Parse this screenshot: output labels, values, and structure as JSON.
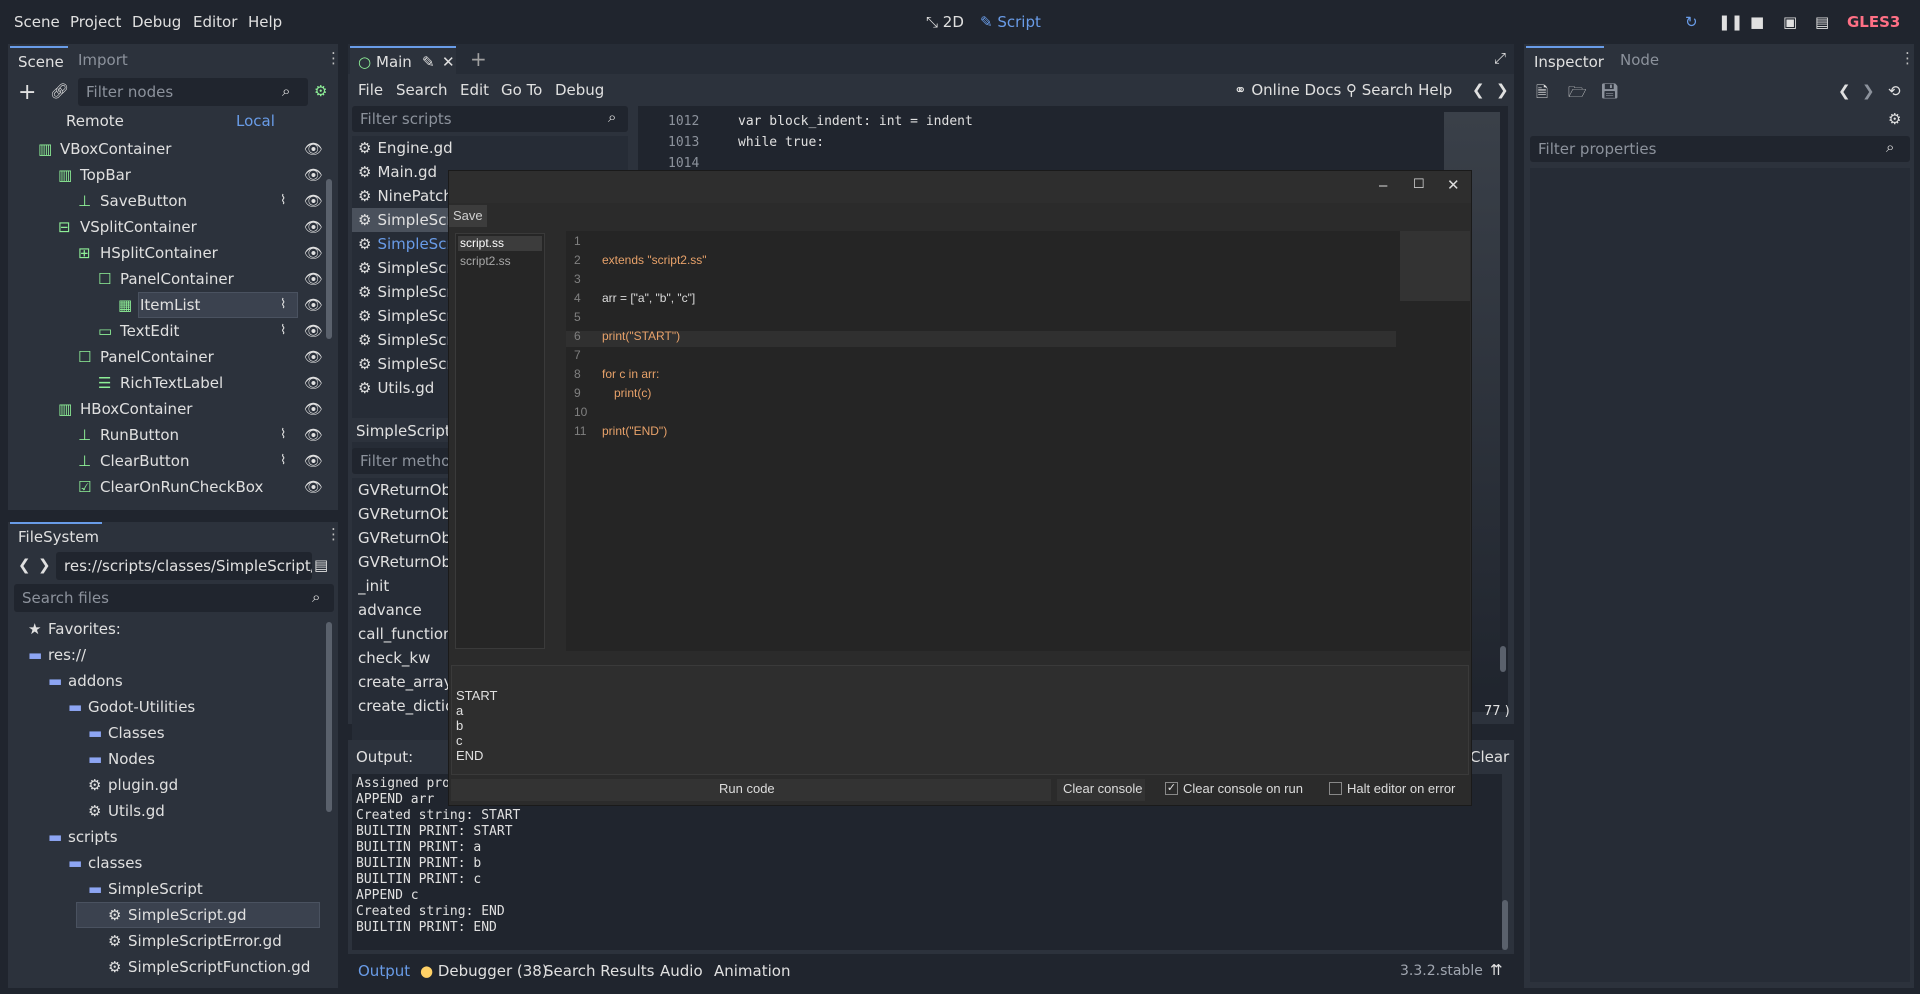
{
  "menubar": {
    "items": [
      "Scene",
      "Project",
      "Debug",
      "Editor",
      "Help"
    ],
    "workspace_2d": "2D",
    "workspace_script": "Script",
    "renderer": "GLES3"
  },
  "scene_dock": {
    "tabs": [
      "Scene",
      "Import"
    ],
    "filter_placeholder": "Filter nodes",
    "remote": "Remote",
    "local": "Local",
    "nodes": [
      {
        "label": "VBoxContainer",
        "icon": "vbox-icon",
        "indent": 0,
        "signal": false
      },
      {
        "label": "TopBar",
        "icon": "hbox-icon",
        "indent": 1,
        "signal": false
      },
      {
        "label": "SaveButton",
        "icon": "button-icon",
        "indent": 2,
        "signal": true
      },
      {
        "label": "VSplitContainer",
        "icon": "vsplit-icon",
        "indent": 1,
        "signal": false
      },
      {
        "label": "HSplitContainer",
        "icon": "hsplit-icon",
        "indent": 2,
        "signal": false
      },
      {
        "label": "PanelContainer",
        "icon": "panel-icon",
        "indent": 3,
        "signal": false
      },
      {
        "label": "ItemList",
        "icon": "itemlist-icon",
        "indent": 4,
        "signal": true
      },
      {
        "label": "TextEdit",
        "icon": "textedit-icon",
        "indent": 3,
        "signal": true
      },
      {
        "label": "PanelContainer",
        "icon": "panel-icon",
        "indent": 2,
        "signal": false
      },
      {
        "label": "RichTextLabel",
        "icon": "richtext-icon",
        "indent": 3,
        "signal": false
      },
      {
        "label": "HBoxContainer",
        "icon": "hbox-icon",
        "indent": 1,
        "signal": false
      },
      {
        "label": "RunButton",
        "icon": "button-icon",
        "indent": 2,
        "signal": true
      },
      {
        "label": "ClearButton",
        "icon": "button-icon",
        "indent": 2,
        "signal": true
      },
      {
        "label": "ClearOnRunCheckBox",
        "icon": "checkbox-icon",
        "indent": 2,
        "signal": false
      }
    ]
  },
  "filesystem": {
    "title": "FileSystem",
    "path": "res://scripts/classes/SimpleScript/Si",
    "search_placeholder": "Search files",
    "items": [
      {
        "label": "Favorites:",
        "type": "star",
        "indent": 0
      },
      {
        "label": "res://",
        "type": "folder",
        "indent": 0
      },
      {
        "label": "addons",
        "type": "folder",
        "indent": 1
      },
      {
        "label": "Godot-Utilities",
        "type": "folder",
        "indent": 2
      },
      {
        "label": "Classes",
        "type": "folder",
        "indent": 3
      },
      {
        "label": "Nodes",
        "type": "folder",
        "indent": 3
      },
      {
        "label": "plugin.gd",
        "type": "gear",
        "indent": 3
      },
      {
        "label": "Utils.gd",
        "type": "gear",
        "indent": 3
      },
      {
        "label": "scripts",
        "type": "folder",
        "indent": 1
      },
      {
        "label": "classes",
        "type": "folder",
        "indent": 2
      },
      {
        "label": "SimpleScript",
        "type": "folder",
        "indent": 3
      },
      {
        "label": "SimpleScript.gd",
        "type": "gear",
        "indent": 4
      },
      {
        "label": "SimpleScriptError.gd",
        "type": "gear",
        "indent": 4
      },
      {
        "label": "SimpleScriptFunction.gd",
        "type": "gear",
        "indent": 4
      }
    ]
  },
  "editor": {
    "tab_main": "Main",
    "menu": [
      "File",
      "Search",
      "Edit",
      "Go To",
      "Debug"
    ],
    "online_docs": "Online Docs",
    "search_help": "Search Help",
    "filter_scripts": "Filter scripts",
    "scripts": [
      "Engine.gd",
      "Main.gd",
      "NinePatch",
      "SimpleScri",
      "SimpleScri",
      "SimpleScri",
      "SimpleScri",
      "SimpleScri",
      "SimpleScri",
      "SimpleScri",
      "Utils.gd"
    ],
    "current_script": "SimpleScript.",
    "filter_methods": "Filter method",
    "methods": [
      "GVReturnObje",
      "GVReturnObje",
      "GVReturnObje",
      "GVReturnObje",
      "_init",
      "advance",
      "call_function",
      "check_kw",
      "create_array",
      "create_dictio"
    ],
    "code": [
      {
        "num": "1012",
        "text": "var block_indent: int = indent"
      },
      {
        "num": "1013",
        "text": "while true:"
      },
      {
        "num": "1014",
        "text": ""
      }
    ],
    "status_line": "77 )"
  },
  "output": {
    "title": "Output:",
    "clear": "Clear",
    "lines": [
      "Assigned pro",
      "APPEND arr",
      "Created string: START",
      "BUILTIN PRINT: START",
      "BUILTIN PRINT: a",
      "BUILTIN PRINT: b",
      "BUILTIN PRINT: c",
      "APPEND c",
      "Created string: END",
      "BUILTIN PRINT: END"
    ]
  },
  "bottom_bar": {
    "tabs": [
      "Output",
      "Debugger (38)",
      "Search Results",
      "Audio",
      "Animation"
    ],
    "version": "3.3.2.stable"
  },
  "inspector": {
    "tabs": [
      "Inspector",
      "Node"
    ],
    "filter_placeholder": "Filter properties"
  },
  "dialog": {
    "save": "Save",
    "files": [
      "script.ss",
      "script2.ss"
    ],
    "code_lines": [
      {
        "num": "1",
        "text": ""
      },
      {
        "num": "2",
        "text": "extends \"script2.ss\""
      },
      {
        "num": "3",
        "text": ""
      },
      {
        "num": "4",
        "text": "arr = [\"a\", \"b\", \"c\"]"
      },
      {
        "num": "5",
        "text": ""
      },
      {
        "num": "6",
        "text": "print(\"START\")"
      },
      {
        "num": "7",
        "text": ""
      },
      {
        "num": "8",
        "text": "for c in arr:"
      },
      {
        "num": "9",
        "text": "print(c)"
      },
      {
        "num": "10",
        "text": ""
      },
      {
        "num": "11",
        "text": "print(\"END\")"
      }
    ],
    "console": [
      "START",
      "a",
      "b",
      "c",
      "END"
    ],
    "run_code": "Run code",
    "clear_console": "Clear console",
    "clear_on_run": "Clear console on run",
    "halt_on_error": "Halt editor on error"
  },
  "colors": {
    "accent": "#699ce8",
    "keyword": "#ff7085",
    "string": "#ffeda1",
    "dlg_keyword": "#e0622b",
    "dlg_string": "#e8e35a"
  }
}
